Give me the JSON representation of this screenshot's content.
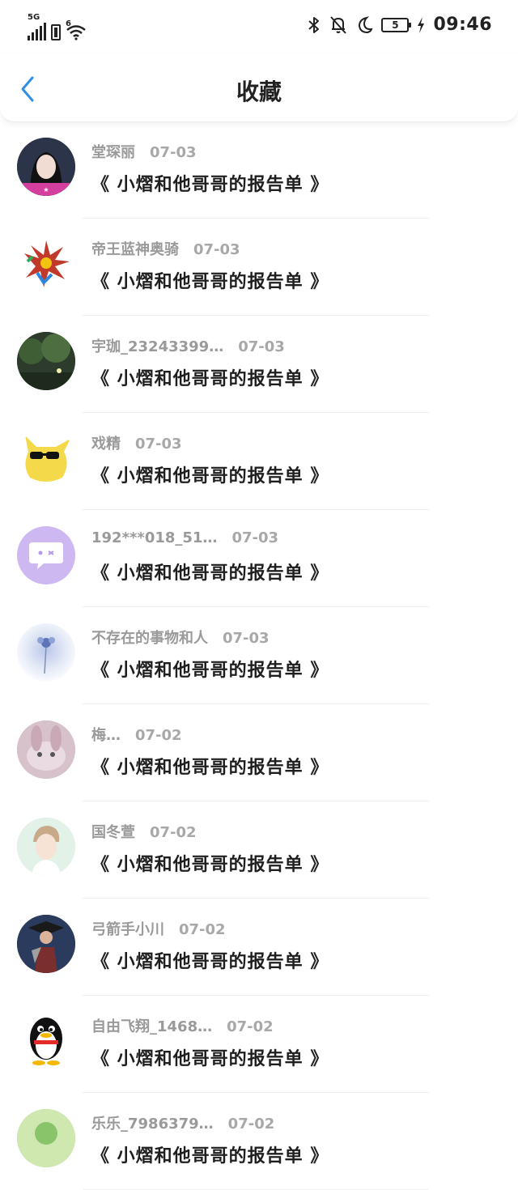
{
  "status_bar": {
    "network_label": "5G",
    "wifi_label": "6",
    "battery_level": "5",
    "time": "09:46"
  },
  "header": {
    "title": "收藏"
  },
  "items": [
    {
      "author": "堂琛丽",
      "date": "07-03",
      "title": "《 小熠和他哥哥的报告单 》",
      "avatar": "photo-girl",
      "avatar_colors": [
        "#1f2a3a",
        "#c8c8d8"
      ]
    },
    {
      "author": "帝王蓝神奥骑",
      "date": "07-03",
      "title": "《 小熠和他哥哥的报告单 》",
      "avatar": "dragon-figure",
      "avatar_colors": [
        "#ffffff",
        "#c0392b"
      ]
    },
    {
      "author": "宇珈_23243399…",
      "date": "07-03",
      "title": "《 小熠和他哥哥的报告单 》",
      "avatar": "night-trees",
      "avatar_colors": [
        "#2f4a2a",
        "#6e8a5e"
      ]
    },
    {
      "author": "戏精",
      "date": "07-03",
      "title": "《 小熠和他哥哥的报告单 》",
      "avatar": "yellow-character",
      "avatar_colors": [
        "#ffffff",
        "#f4d94a"
      ]
    },
    {
      "author": "192***018_51…",
      "date": "07-03",
      "title": "《 小熠和他哥哥的报告单 》",
      "avatar": "chat-bubble",
      "avatar_colors": [
        "#cdb8f2",
        "#ffffff"
      ]
    },
    {
      "author": "不存在的事物和人",
      "date": "07-03",
      "title": "《 小熠和他哥哥的报告单 》",
      "avatar": "blue-flower",
      "avatar_colors": [
        "#ffffff",
        "#c8d4ee"
      ]
    },
    {
      "author": "梅…",
      "date": "07-02",
      "title": "《 小熠和他哥哥的报告单 》",
      "avatar": "pink-bunny",
      "avatar_colors": [
        "#d9c3cc",
        "#a98d9a"
      ]
    },
    {
      "author": "国冬萱",
      "date": "07-02",
      "title": "《 小熠和他哥哥的报告单 》",
      "avatar": "boy-photo",
      "avatar_colors": [
        "#dff0e6",
        "#a7c9b4"
      ]
    },
    {
      "author": "弓箭手小川",
      "date": "07-02",
      "title": "《 小熠和他哥哥的报告单 》",
      "avatar": "game-character",
      "avatar_colors": [
        "#25324a",
        "#8a3a3a"
      ]
    },
    {
      "author": "自由飞翔_1468…",
      "date": "07-02",
      "title": "《 小熠和他哥哥的报告单 》",
      "avatar": "penguin",
      "avatar_colors": [
        "#ffffff",
        "#111111"
      ]
    },
    {
      "author": "乐乐_7986379…",
      "date": "07-02",
      "title": "《 小熠和他哥哥的报告单 》",
      "avatar": "green-photo",
      "avatar_colors": [
        "#8ac46a",
        "#e2f0c8"
      ]
    }
  ]
}
